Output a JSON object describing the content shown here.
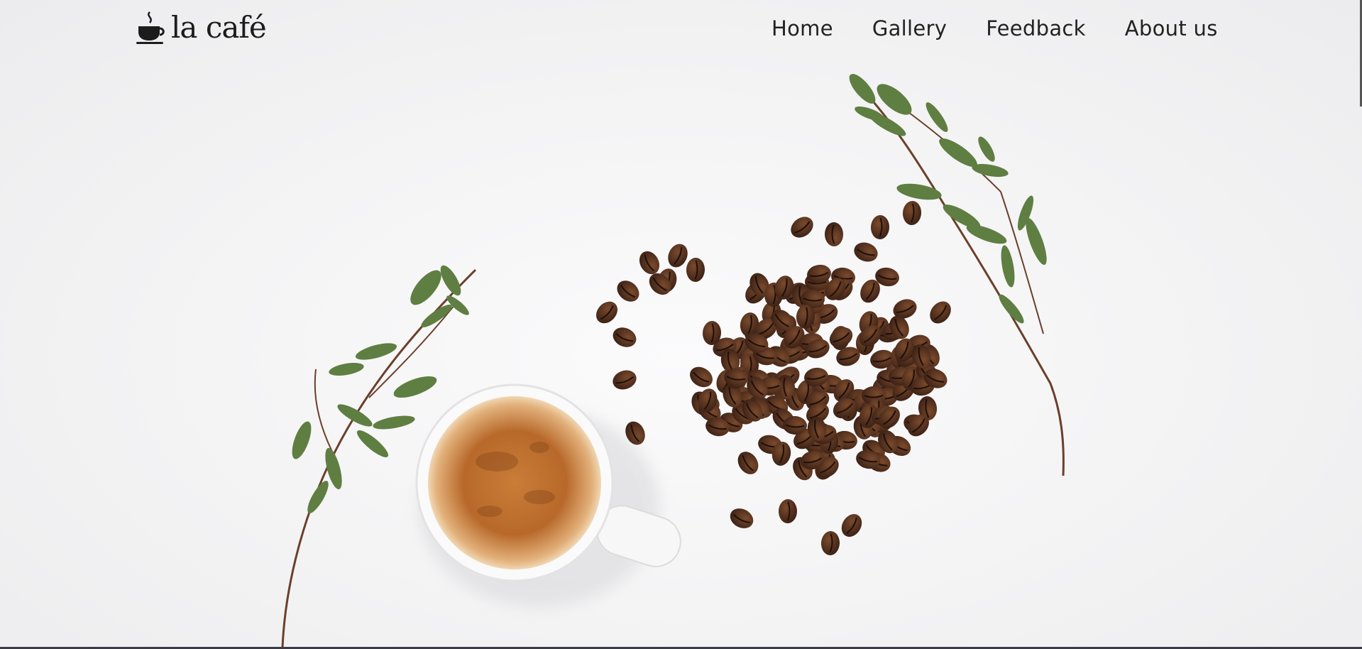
{
  "header": {
    "logo_text": "la café",
    "logo_icon": "coffee-cup-icon"
  },
  "nav": {
    "items": [
      {
        "label": "Home"
      },
      {
        "label": "Gallery"
      },
      {
        "label": "Feedback"
      },
      {
        "label": "About us"
      }
    ]
  },
  "hero": {
    "image": "coffee-cup-beans-eucalyptus-photo"
  },
  "colors": {
    "background": "#f2f2f3",
    "text": "#222222",
    "leaf": "#5a7a3e",
    "bean": "#4a2c1c",
    "coffee": "#b06a2c"
  }
}
